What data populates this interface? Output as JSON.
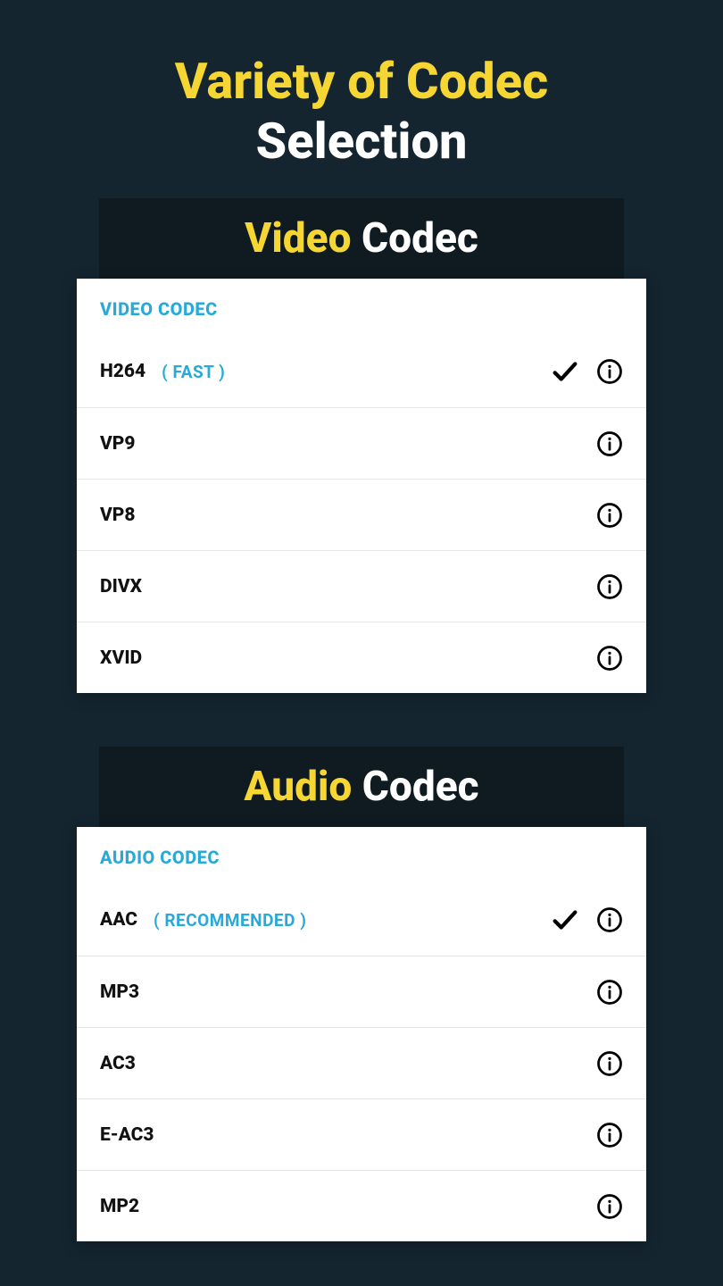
{
  "hero": {
    "line1": "Variety of Codec",
    "line2": "Selection"
  },
  "video_section": {
    "header_accent": "Video",
    "header_white": " Codec",
    "card_title": "VIDEO CODEC",
    "items": [
      {
        "label": "H264",
        "tag": "( FAST )",
        "selected": true
      },
      {
        "label": "VP9",
        "tag": "",
        "selected": false
      },
      {
        "label": "VP8",
        "tag": "",
        "selected": false
      },
      {
        "label": "DIVX",
        "tag": "",
        "selected": false
      },
      {
        "label": "XVID",
        "tag": "",
        "selected": false
      }
    ]
  },
  "audio_section": {
    "header_accent": "Audio",
    "header_white": " Codec",
    "card_title": "AUDIO CODEC",
    "items": [
      {
        "label": "AAC",
        "tag": "( RECOMMENDED )",
        "selected": true
      },
      {
        "label": "MP3",
        "tag": "",
        "selected": false
      },
      {
        "label": "AC3",
        "tag": "",
        "selected": false
      },
      {
        "label": "E-AC3",
        "tag": "",
        "selected": false
      },
      {
        "label": "MP2",
        "tag": "",
        "selected": false
      }
    ]
  }
}
